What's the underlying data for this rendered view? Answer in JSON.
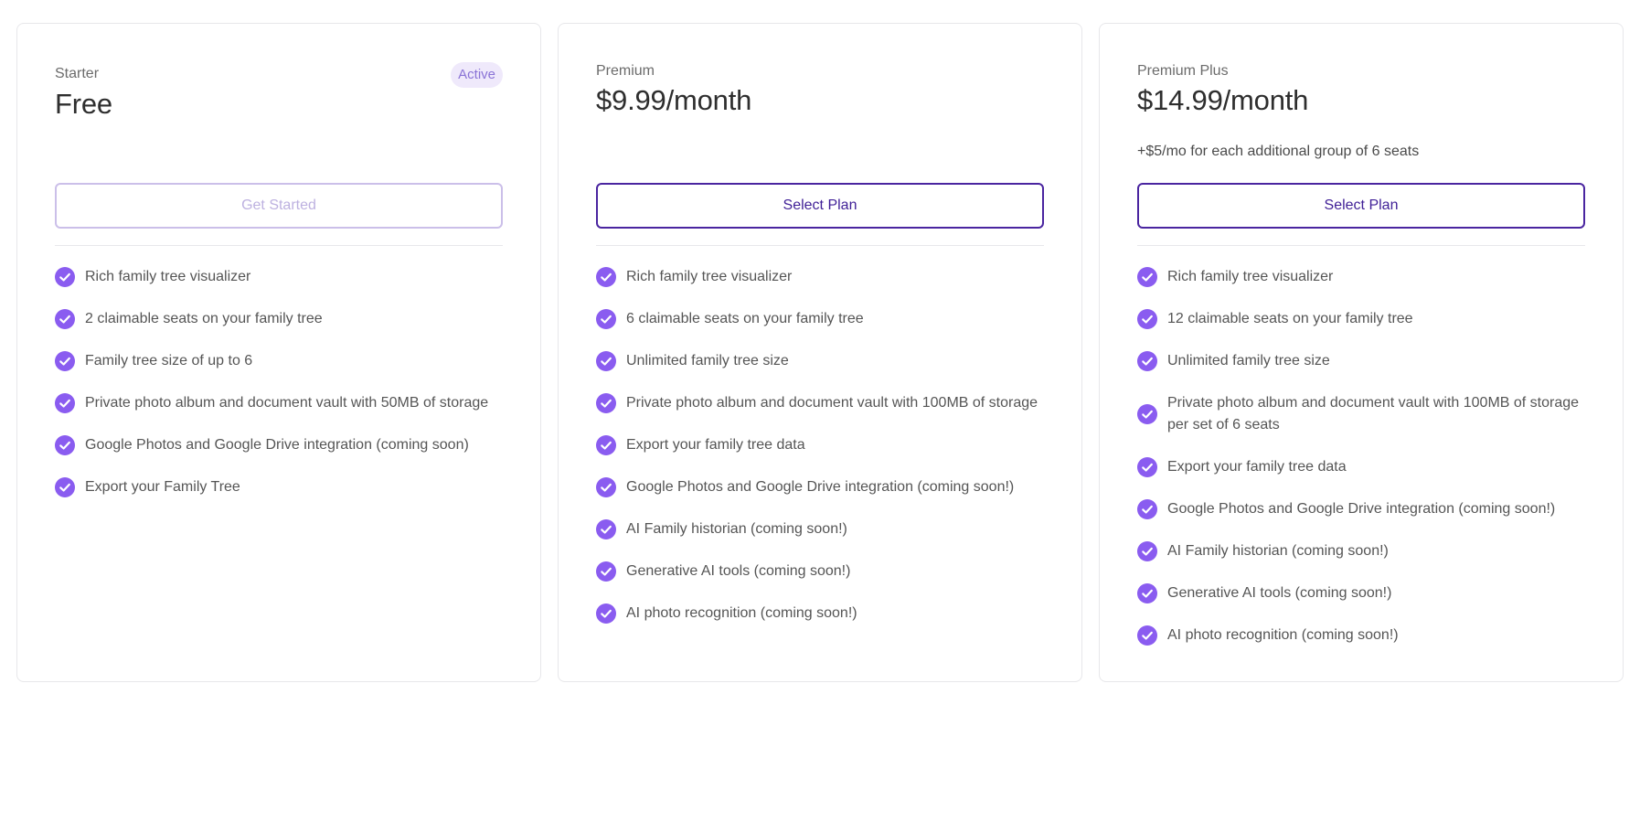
{
  "plans": [
    {
      "tier": "Starter",
      "badge": "Active",
      "price": "Free",
      "note": "",
      "button_label": "Get Started",
      "features": [
        "Rich family tree visualizer",
        "2 claimable seats on your family tree",
        "Family tree size of up to 6",
        "Private photo album and document vault with 50MB of storage",
        "Google Photos and Google Drive integration (coming soon)",
        "Export your Family Tree"
      ]
    },
    {
      "tier": "Premium",
      "badge": "",
      "price": "$9.99/month",
      "note": "",
      "button_label": "Select Plan",
      "features": [
        "Rich family tree visualizer",
        "6 claimable seats on your family tree",
        "Unlimited family tree size",
        "Private photo album and document vault with 100MB of storage",
        "Export your family tree data",
        "Google Photos and Google Drive integration (coming soon!)",
        "AI Family historian (coming soon!)",
        "Generative AI tools (coming soon!)",
        "AI photo recognition (coming soon!)"
      ]
    },
    {
      "tier": "Premium Plus",
      "badge": "",
      "price": "$14.99/month",
      "note": "+$5/mo for each additional group of 6 seats",
      "button_label": "Select Plan",
      "features": [
        "Rich family tree visualizer",
        "12 claimable seats on your family tree",
        "Unlimited family tree size",
        "Private photo album and document vault with 100MB of storage per set of 6 seats",
        "Export your family tree data",
        "Google Photos and Google Drive integration (coming soon!)",
        "AI Family historian (coming soon!)",
        "Generative AI tools (coming soon!)",
        "AI photo recognition (coming soon!)"
      ]
    }
  ],
  "colors": {
    "accent": "#8a5cf0",
    "button_border": "#4a25a0",
    "badge_bg": "#efe9fb",
    "badge_text": "#8a73d6"
  },
  "icons": {
    "feature": "check-circle-icon"
  }
}
